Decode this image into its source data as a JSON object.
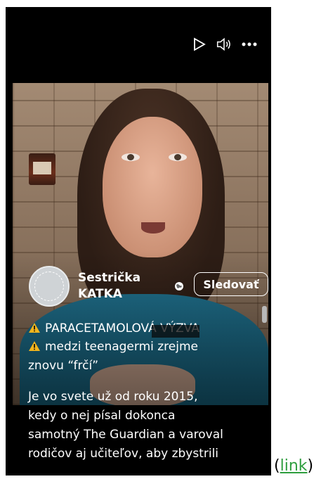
{
  "controls": {
    "icons": [
      "play-icon",
      "volume-icon",
      "more-icon"
    ]
  },
  "author": {
    "name_line1": "Sestrička",
    "name_line2": "KATKA",
    "follow_label": "Sledovať"
  },
  "caption": {
    "line1": "PARACETAMOLOVÁ VÝZVA",
    "line2": "medzi teenagermi zrejme",
    "line3": "znovu “frčí”",
    "warn_color": "#f2b51d"
  },
  "post_text": [
    "Je vo svete už od roku 2015,",
    "kedy o nej písal dokonca",
    "samotný The Guardian a varoval",
    "rodičov aj učiteľov, aby zbystrili"
  ],
  "link": {
    "open": "(",
    "label": "link",
    "close": ")"
  }
}
